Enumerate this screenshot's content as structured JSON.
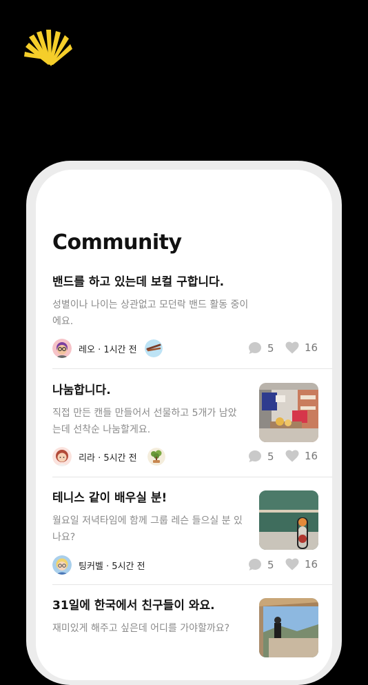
{
  "colors": {
    "logo": "#F5CE2A",
    "background": "#000000",
    "frame": "#ECECEC"
  },
  "screen": {
    "title": "Community"
  },
  "posts": [
    {
      "title": "밴드를 하고 있는데 보컬 구합니다.",
      "body": "성별이나 나이는 상관없고 모던락 밴드 활동 중이에요.",
      "author": "레오",
      "time": "· 1시간 전",
      "comments": "5",
      "likes": "16",
      "avatar": "avatar-leo",
      "badge": "drumsticks-badge"
    },
    {
      "title": "나눔합니다.",
      "body": "직접 만든 캔들 만들어서 선물하고 5개가 남았는데 선착순 나눔할게요.",
      "author": "리라",
      "time": "· 5시간 전",
      "comments": "5",
      "likes": "16",
      "avatar": "avatar-lira",
      "badge": "bonsai-badge",
      "thumbnail": "shop-interior-photo"
    },
    {
      "title": "테니스 같이 배우실 분!",
      "body": "월요일 저녁타임에 함께 그룹 레슨 들으실 분 있나요?",
      "author": "팅커벨",
      "time": "· 5시간 전",
      "comments": "5",
      "likes": "16",
      "avatar": "avatar-tinkerbell",
      "thumbnail": "tennis-balls-photo"
    },
    {
      "title": "31일에 한국에서 친구들이 와요.",
      "body": "재미있게 해주고 싶은데 어디를 가야할까요?",
      "thumbnail": "terrace-photo"
    }
  ]
}
